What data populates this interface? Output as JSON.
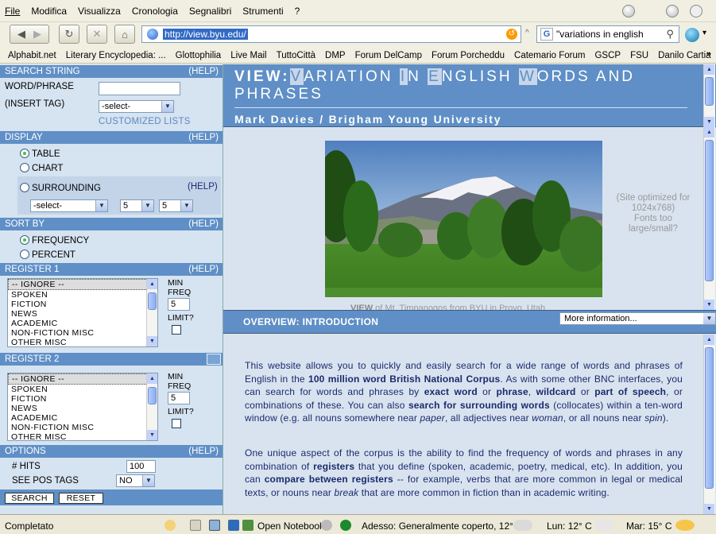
{
  "menu": [
    "File",
    "Modifica",
    "Visualizza",
    "Cronologia",
    "Segnalibri",
    "Strumenti",
    "?"
  ],
  "nav": {
    "url": "http://view.byu.edu/",
    "search_query": "\"variations in english"
  },
  "bookmarks": [
    "Alphabit.net",
    "Literary Encyclopedia: ...",
    "Glottophilia",
    "Live Mail",
    "TuttoCittà",
    "DMP",
    "Forum DelCamp",
    "Forum Porcheddu",
    "Catemario Forum",
    "GSCP",
    "FSU",
    "Danilo Cartia"
  ],
  "bookmarks_more": "»",
  "left": {
    "search": {
      "header": "SEARCH STRING",
      "help": "(HELP)",
      "word_label": "WORD/PHRASE",
      "word_value": "",
      "tag_label": "(INSERT TAG)",
      "tag_select": "-select-",
      "customized": "CUSTOMIZED LISTS"
    },
    "display": {
      "header": "DISPLAY",
      "help": "(HELP)",
      "table": "TABLE",
      "chart": "CHART",
      "surrounding": "SURROUNDING",
      "surround_help": "(HELP)",
      "sel1": "-select-",
      "sel2": "5",
      "sel3": "5"
    },
    "sort": {
      "header": "SORT BY",
      "help": "(HELP)",
      "frequency": "FREQUENCY",
      "percent": "PERCENT"
    },
    "register1": {
      "header": "REGISTER 1",
      "help": "(HELP)",
      "options": [
        "-- IGNORE --",
        "SPOKEN",
        "FICTION",
        "NEWS",
        "ACADEMIC",
        "NON-FICTION MISC",
        "OTHER MISC"
      ],
      "min_label": "MIN",
      "freq_label": "FREQ",
      "min_value": "5",
      "limit_label": "LIMIT?"
    },
    "register2": {
      "header": "REGISTER 2",
      "options": [
        "-- IGNORE --",
        "SPOKEN",
        "FICTION",
        "NEWS",
        "ACADEMIC",
        "NON-FICTION MISC",
        "OTHER MISC"
      ],
      "min_label": "MIN",
      "freq_label": "FREQ",
      "min_value": "5",
      "limit_label": "LIMIT?"
    },
    "options": {
      "header": "OPTIONS",
      "help": "(HELP)",
      "hits_label": "# HITS",
      "hits_value": "100",
      "pos_label": "SEE POS TAGS",
      "pos_value": "NO"
    },
    "buttons": {
      "search": "SEARCH",
      "reset": "RESET"
    }
  },
  "title": {
    "view_word": "VIEW:",
    "subtitle": "Mark Davies / Brigham Young University"
  },
  "photo": {
    "caption_bold": "VIEW",
    "caption_rest": " of Mt. Timpanogos from BYU in Provo, Utah"
  },
  "site_note": {
    "line1": "(Site optimized for",
    "line2": "1024x768)",
    "line3": "Fonts too",
    "line4": "large/small?"
  },
  "overview": {
    "title": "OVERVIEW: INTRODUCTION",
    "more": "More information..."
  },
  "status": {
    "left": "Completato",
    "notebook": "Open Notebook",
    "weather_now": "Adesso: Generalmente coperto, 12° C",
    "lun": "Lun: 12° C",
    "mar": "Mar: 15° C"
  },
  "colors": {
    "panel_blue": "#5f8fc6",
    "panel_light": "#d9e3ef",
    "text_navy": "#1a2a6e"
  }
}
